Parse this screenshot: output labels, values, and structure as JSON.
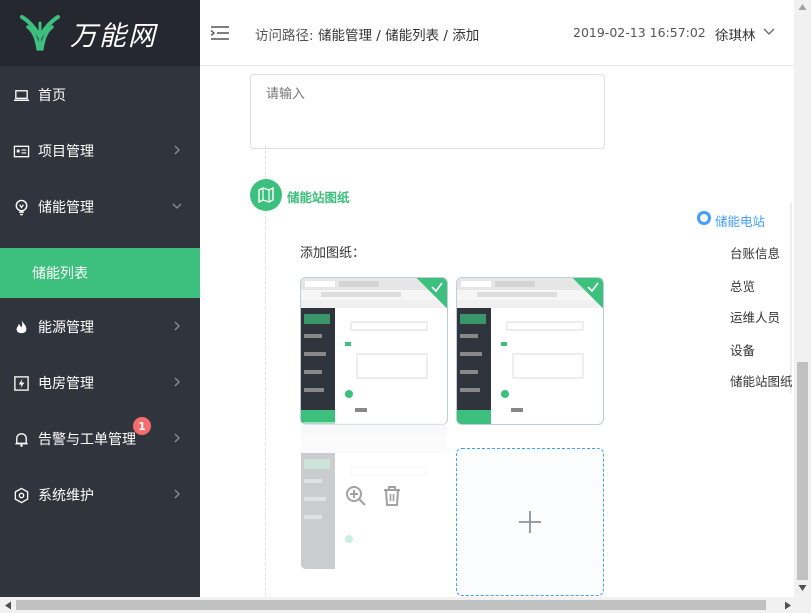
{
  "brand": {
    "name": "万能网"
  },
  "sidebar": {
    "items": [
      {
        "label": "首页",
        "icon": "laptop-icon"
      },
      {
        "label": "项目管理",
        "icon": "id-card-icon"
      },
      {
        "label": "储能管理",
        "icon": "bulb-icon"
      },
      {
        "label": "能源管理",
        "icon": "fire-icon"
      },
      {
        "label": "电房管理",
        "icon": "lightning-box-icon"
      },
      {
        "label": "告警与工单管理",
        "icon": "bell-icon",
        "badge": "1"
      },
      {
        "label": "系统维护",
        "icon": "hexagon-icon"
      }
    ],
    "active_sub": "储能列表"
  },
  "header": {
    "breadcrumb_label": "访问路径:",
    "breadcrumb": "储能管理 / 储能列表 / 添加",
    "datetime": "2019-02-13 16:57:02",
    "user": "徐琪林"
  },
  "form": {
    "textarea_placeholder": "请输入",
    "section_title": "储能站图纸",
    "add_label": "添加图纸："
  },
  "anchor": {
    "items": [
      "储能电站",
      "台账信息",
      "总览",
      "运维人员",
      "设备",
      "储能站图纸"
    ],
    "active_index": 0
  },
  "colors": {
    "accent": "#3dbf7e",
    "sidebar_bg": "#30343d",
    "logo_bg": "#252830",
    "link": "#409eff",
    "badge": "#f56c6c"
  }
}
